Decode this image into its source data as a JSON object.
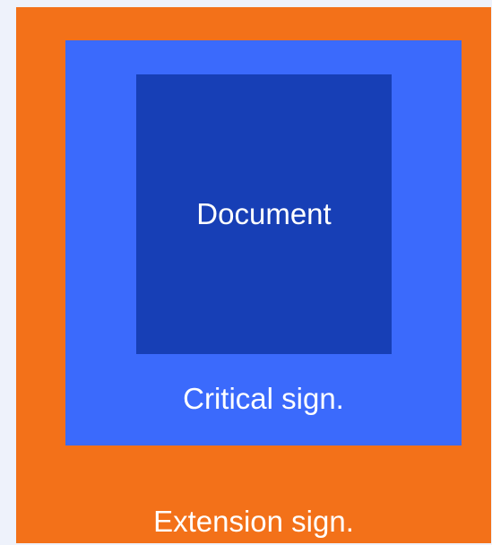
{
  "diagram": {
    "layers": {
      "outer": {
        "label": "Extension sign.",
        "color": "#f37119"
      },
      "middle": {
        "label": "Critical sign.",
        "color": "#3b6afc"
      },
      "inner": {
        "label": "Document",
        "color": "#173fb6"
      }
    },
    "background_color": "#eef2fb",
    "text_color": "#ffffff"
  }
}
